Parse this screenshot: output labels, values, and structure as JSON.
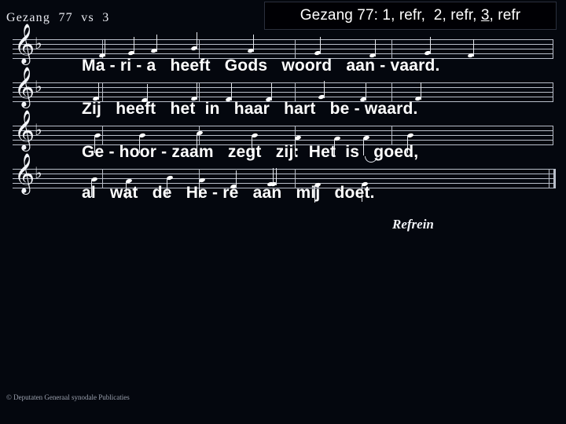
{
  "slide": {
    "background_color": "#04070e",
    "title": "Gezang  77  vs  3",
    "refrain_label": "Refrein",
    "copyright": "© Deputaten Generaal synodale Publicaties"
  },
  "overlay_banner": {
    "name": "gezang-verse-order-banner",
    "text_before": "Gezang 77: 1, refr,  2, refr, ",
    "text_underlined": "3",
    "text_after": ", refr",
    "background_color": "#000004",
    "text_color": "#ffffff"
  },
  "music": {
    "clef_glyph": "𝄞",
    "clef_name": "treble-clef",
    "key_signature_glyph": "♭",
    "key_signature": "1 flat (B-flat)",
    "staff_line_color": "#b9bec9",
    "note_color": "#ffffff",
    "systems": [
      {
        "index": 1,
        "lyric_line": "Ma - ri - a   heeft   Gods   woord   aan - vaard.",
        "notes": 9,
        "barlines": 5
      },
      {
        "index": 2,
        "lyric_line": "Zij   heeft   het  in   haar   hart   be - waard.",
        "notes": 8,
        "barlines": 5
      },
      {
        "index": 3,
        "lyric_line": "Ge - hoor - zaam   zegt   zij:  Het  is   goed,",
        "notes": 8,
        "barlines": 5
      },
      {
        "index": 4,
        "lyric_line": "al   wat   de   He - re   aan   mij   doet.",
        "notes": 8,
        "barlines": 4
      }
    ]
  },
  "lyrics": {
    "line1": "Ma - ri - a   heeft   Gods   woord   aan - vaard.",
    "line2": "Zij   heeft   het  in   haar   hart   be - waard.",
    "line3": "Ge - hoor - zaam   zegt   zij:  Het  is   goed,",
    "line4": "al   wat   de   He - re   aan   mij   doet."
  }
}
